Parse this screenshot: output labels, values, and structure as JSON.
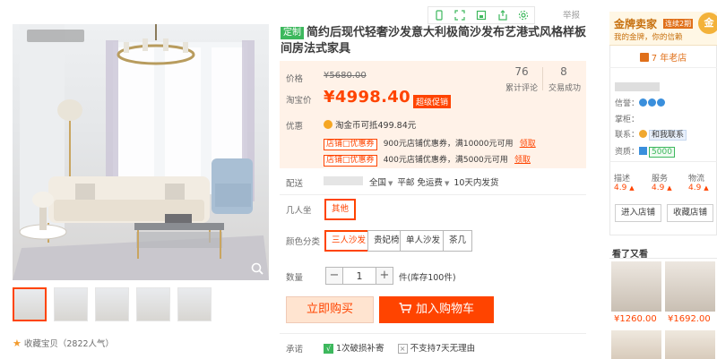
{
  "title": {
    "tag": "定制",
    "text": "简约后现代轻奢沙发意大利极简沙发布艺港式风格样板间房法式家具"
  },
  "toolbar": {
    "report": "举报",
    "icons": [
      "phone-icon",
      "expand-icon",
      "save-icon",
      "share-icon",
      "settings-icon"
    ]
  },
  "price": {
    "orig_label": "价格",
    "orig_value": "¥5680.00",
    "sale_label": "淘宝价",
    "sale_value": "¥4998.40",
    "sale_badge": "超级促销",
    "reviews_count": "76",
    "reviews_label": "累计评论",
    "deals_count": "8",
    "deals_label": "交易成功",
    "promo_label": "优惠",
    "coin_text": "淘金币可抵499.84元",
    "coupons": [
      {
        "tag": "店铺□优惠券",
        "text": "900元店铺优惠券，满10000元可用",
        "action": "领取"
      },
      {
        "tag": "店铺□优惠券",
        "text": "400元店铺优惠券，满5000元可用",
        "action": "领取"
      }
    ]
  },
  "shipping": {
    "label": "配送",
    "region": "全国",
    "method": "平邮 免运费",
    "eta": "10天内发货"
  },
  "options": {
    "seats_label": "几人坐",
    "seats": [
      "其他"
    ],
    "seats_selected": 0,
    "color_label": "颜色分类",
    "colors": [
      "三人沙发",
      "贵妃椅",
      "单人沙发",
      "茶几"
    ],
    "colors_selected": 0
  },
  "quantity": {
    "label": "数量",
    "value": "1",
    "minus": "−",
    "plus": "+",
    "stock": "件(库存100件)"
  },
  "actions": {
    "buy_now": "立即购买",
    "add_to_cart": "加入购物车"
  },
  "service": {
    "label": "承诺",
    "items": [
      "1次破损补寄",
      "不支持7天无理由"
    ]
  },
  "gallery": {
    "favorite": "收藏宝贝（2822人气）",
    "thumb_count": 5,
    "active_thumb": 0
  },
  "seller": {
    "gold_title": "金牌卖家",
    "gold_badge": "连续2期",
    "gold_sub": "我的金牌，你的信赖",
    "medal": "金",
    "years": "7 年老店",
    "credit_label": "信誉：",
    "keeper_label": "掌柜：",
    "contact_label": "联系：",
    "contact_link": "和我联系",
    "qual_label": "资质：",
    "qual_badge": "5000",
    "scores": [
      {
        "name": "描述",
        "value": "4.9"
      },
      {
        "name": "服务",
        "value": "4.9"
      },
      {
        "name": "物流",
        "value": "4.9"
      }
    ],
    "enter_shop": "进入店铺",
    "save_shop": "收藏店铺"
  },
  "also_viewed": {
    "title": "看了又看",
    "items": [
      {
        "price": "¥1260.00"
      },
      {
        "price": "¥1692.00"
      }
    ]
  },
  "colors": {
    "accent": "#ff4400",
    "price_bg": "#fff2e8",
    "tag_green": "#3db85d",
    "gold": "#c7700e"
  }
}
